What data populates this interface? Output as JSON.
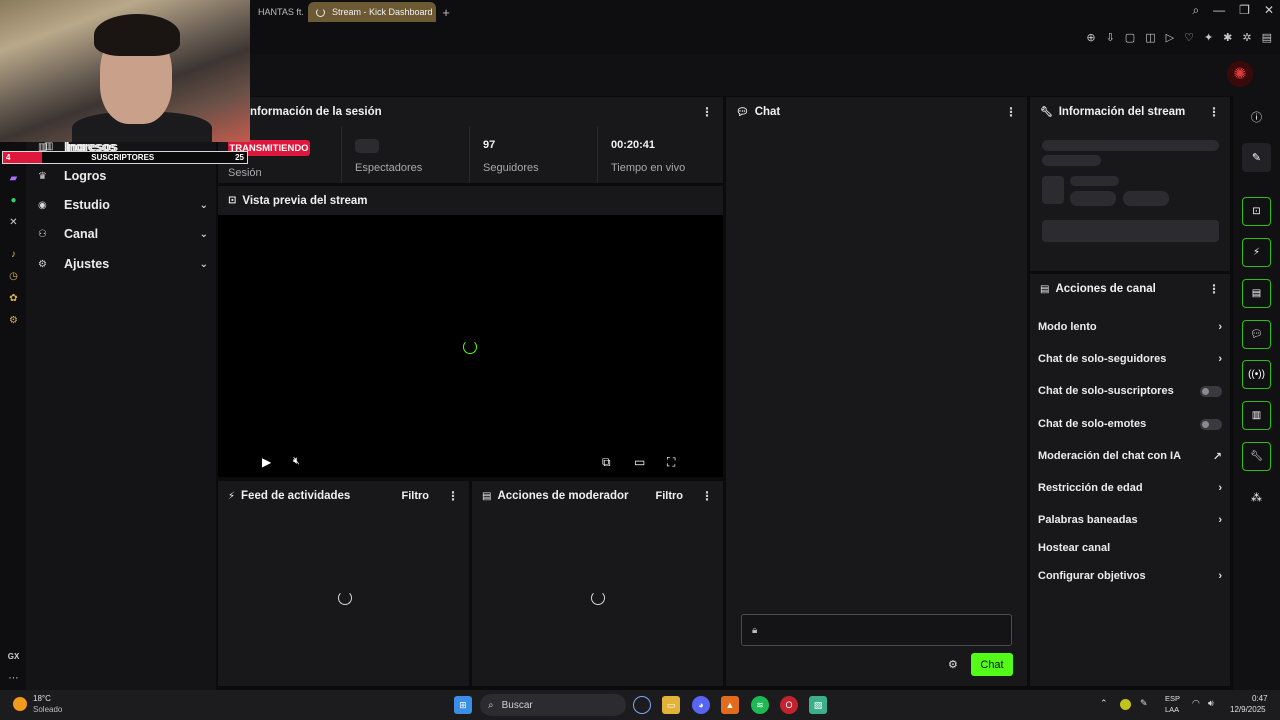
{
  "browser": {
    "tab_prev_label": "HANTAS ft. A",
    "tab_active_label": "Stream - Kick Dashboard",
    "tab_add": "+"
  },
  "overlay": {
    "sub_left": "4",
    "sub_label": "SUSCRIPTORES",
    "sub_right": "25",
    "sub_progress_pct": 16
  },
  "sidebar": {
    "items": [
      {
        "label": "Ingresos",
        "icon": "bar-chart-icon"
      },
      {
        "label": "Logros",
        "icon": "trophy-icon"
      },
      {
        "label": "Estudio",
        "icon": "studio-icon",
        "chevron": true
      },
      {
        "label": "Canal",
        "icon": "users-icon",
        "chevron": true
      },
      {
        "label": "Ajustes",
        "icon": "gear-icon",
        "chevron": true
      }
    ],
    "rail_bottom_label": "GX"
  },
  "session": {
    "title": "nformación de la sesión",
    "status_badge": "TRANSMITIENDO",
    "session_label": "Sesión",
    "viewers_label": "Espectadores",
    "followers_value": "97",
    "followers_label": "Seguidores",
    "live_time_value": "00:20:41",
    "live_time_label": "Tiempo en vivo"
  },
  "preview": {
    "title": "Vista previa del stream"
  },
  "activity": {
    "title": "Feed de actividades",
    "filter_label": "Filtro"
  },
  "mod": {
    "title": "Acciones de moderador",
    "filter_label": "Filtro"
  },
  "chat": {
    "title": "Chat",
    "send_label": "Chat"
  },
  "stream_info": {
    "title": "Información del stream"
  },
  "channel_actions": {
    "title": "Acciones de canal",
    "items": [
      {
        "label": "Modo lento",
        "control": "chevron"
      },
      {
        "label": "Chat de solo-seguidores",
        "control": "chevron"
      },
      {
        "label": "Chat de solo-suscriptores",
        "control": "toggle",
        "on": false
      },
      {
        "label": "Chat de solo-emotes",
        "control": "toggle",
        "on": false
      },
      {
        "label": "Moderación del chat con IA",
        "control": "external"
      },
      {
        "label": "Restricción de edad",
        "control": "chevron"
      },
      {
        "label": "Palabras baneadas",
        "control": "chevron"
      },
      {
        "label": "Hostear canal",
        "control": "none"
      },
      {
        "label": "Configurar objetivos",
        "control": "chevron"
      }
    ]
  },
  "taskbar": {
    "weather_temp": "18°C",
    "weather_desc": "Soleado",
    "search_label": "Buscar",
    "lang_top": "ESP",
    "lang_bottom": "LAA",
    "time": "0:47",
    "date": "12/9/2025"
  },
  "colors": {
    "accent_green": "#53fc18",
    "live_red": "#e0173c",
    "panel_bg": "#18181b"
  }
}
